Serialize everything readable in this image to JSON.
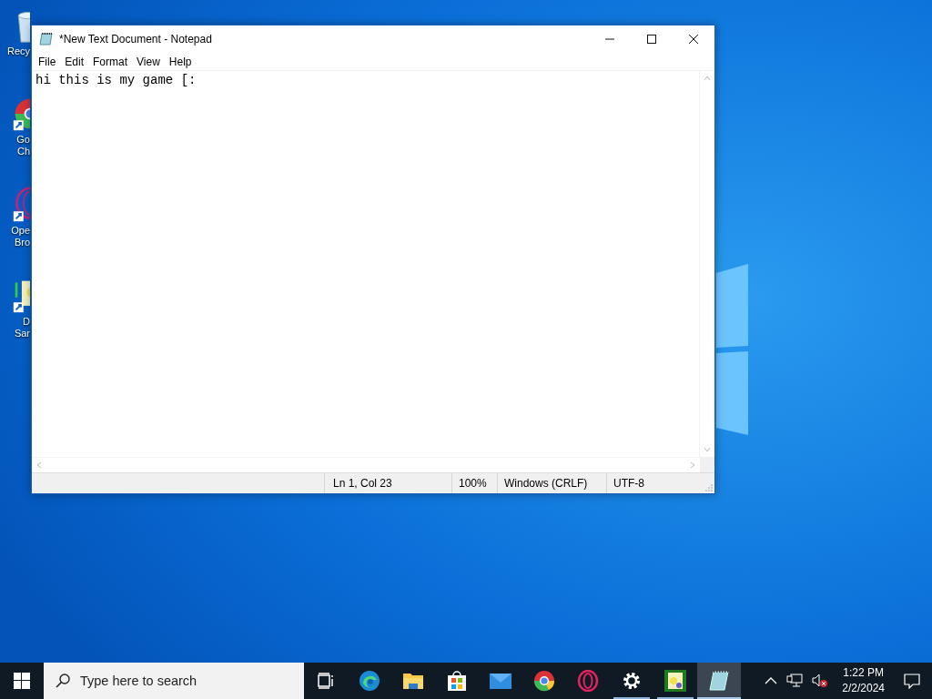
{
  "desktop_icons": [
    {
      "kind": "recycle",
      "lines": [
        "Recy"
      ]
    },
    {
      "kind": "chrome",
      "lines": [
        "Go",
        "Ch"
      ]
    },
    {
      "kind": "opera",
      "lines": [
        "Ope",
        "Bro"
      ]
    },
    {
      "kind": "game",
      "lines": [
        "D",
        "Sar"
      ]
    }
  ],
  "window": {
    "title": "*New Text Document - Notepad",
    "menu": [
      "File",
      "Edit",
      "Format",
      "View",
      "Help"
    ],
    "text": "hi this is my game [:",
    "status_bar": [
      "Ln 1, Col 23",
      "100%",
      "Windows (CRLF)",
      "UTF-8"
    ]
  },
  "taskbar": {
    "search": {
      "placeholder": "Type here to search"
    },
    "apps": [
      {
        "kind": "taskview",
        "running": false,
        "selected": false
      },
      {
        "kind": "edge",
        "running": false,
        "selected": false
      },
      {
        "kind": "explorer",
        "running": false,
        "selected": false
      },
      {
        "kind": "store",
        "running": false,
        "selected": false
      },
      {
        "kind": "mail",
        "running": false,
        "selected": false
      },
      {
        "kind": "chrome",
        "running": false,
        "selected": false
      },
      {
        "kind": "opera",
        "running": false,
        "selected": false
      },
      {
        "kind": "settings",
        "running": true,
        "selected": false
      },
      {
        "kind": "game",
        "running": true,
        "selected": false
      },
      {
        "kind": "notepad",
        "running": true,
        "selected": true
      }
    ],
    "time": "1:22 PM",
    "date": "2/2/2024"
  }
}
